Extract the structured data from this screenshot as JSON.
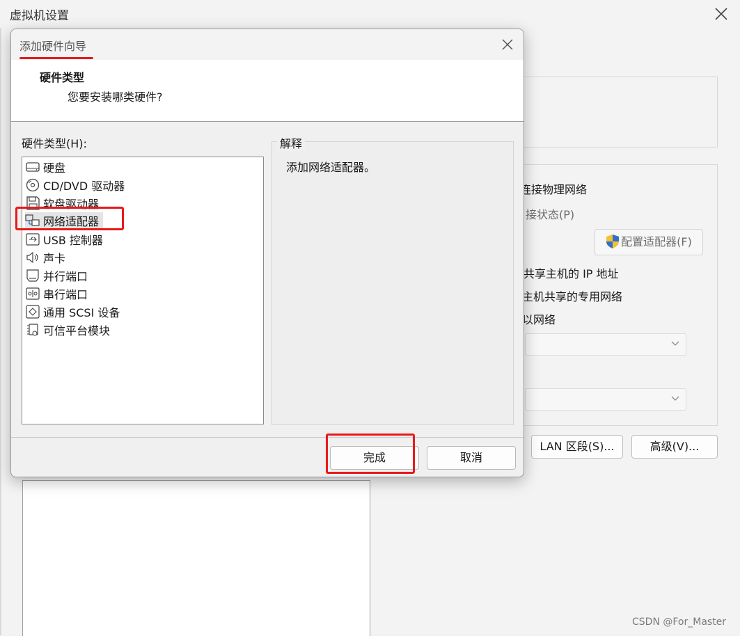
{
  "background_window": {
    "title": "虚拟机设置",
    "options": {
      "bridged_replicate": "连接物理网络",
      "replicate_state": "接状态(P)",
      "configure_adapter": "配置适配器(F)",
      "nat": "共享主机的 IP 地址",
      "host_only": "主机共享的专用网络",
      "custom": "以网络"
    },
    "buttons": {
      "lan_segment": "LAN 区段(S)...",
      "advanced": "高级(V)..."
    }
  },
  "dialog": {
    "title": "添加硬件向导",
    "heading": "硬件类型",
    "subheading": "您要安装哪类硬件?",
    "hardware_label": "硬件类型(H):",
    "hardware_items": [
      {
        "label": "硬盘",
        "icon": "hard-disk-icon"
      },
      {
        "label": "CD/DVD 驱动器",
        "icon": "cd-dvd-icon"
      },
      {
        "label": "软盘驱动器",
        "icon": "floppy-icon"
      },
      {
        "label": "网络适配器",
        "icon": "network-adapter-icon",
        "selected": true
      },
      {
        "label": "USB 控制器",
        "icon": "usb-icon"
      },
      {
        "label": "声卡",
        "icon": "speaker-icon"
      },
      {
        "label": "并行端口",
        "icon": "parallel-port-icon"
      },
      {
        "label": "串行端口",
        "icon": "serial-port-icon"
      },
      {
        "label": "通用 SCSI 设备",
        "icon": "scsi-icon"
      },
      {
        "label": "可信平台模块",
        "icon": "tpm-icon"
      }
    ],
    "explanation_title": "解释",
    "explanation_text": "添加网络适配器。",
    "finish_label": "完成",
    "cancel_label": "取消"
  },
  "watermark": "CSDN @For_Master",
  "colors": {
    "annotation_red": "#e8191a",
    "selection_gray": "#e4e4e4"
  }
}
